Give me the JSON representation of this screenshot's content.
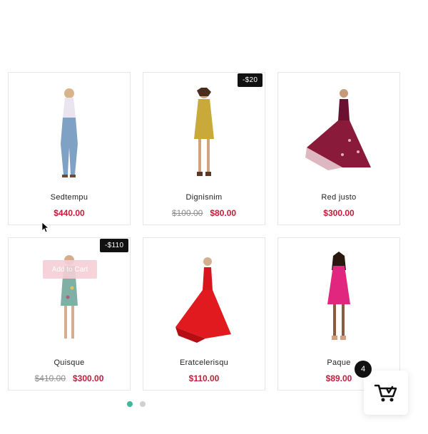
{
  "products": [
    {
      "name": "Sedtempu",
      "price": "$440.00",
      "old_price": "",
      "badge": "",
      "image": "woman-denim-figure"
    },
    {
      "name": "Dignisnim",
      "price": "$80.00",
      "old_price": "$100.00",
      "badge": "-$20",
      "image": "woman-yellow-dress-figure"
    },
    {
      "name": "Red justo",
      "price": "$300.00",
      "old_price": "",
      "badge": "",
      "image": "woman-ballgown-figure"
    },
    {
      "name": "Quisque",
      "price": "$300.00",
      "old_price": "$410.00",
      "badge": "-$110",
      "image": "woman-floral-dress-figure"
    },
    {
      "name": "Eratcelerisqu",
      "price": "$110.00",
      "old_price": "",
      "badge": "",
      "image": "woman-red-dress-figure"
    },
    {
      "name": "Paque",
      "price": "$89.00",
      "old_price": "",
      "badge": "",
      "image": "woman-pink-dress-figure"
    }
  ],
  "ghost_button_label": "Add to Cart",
  "carousel": {
    "pages": 2,
    "active": 0
  },
  "cart": {
    "count": "4",
    "icon": "shopping-cart-icon"
  },
  "colors": {
    "price": "#c8193a",
    "badge_bg": "#111111",
    "dot_active": "#3db898"
  }
}
